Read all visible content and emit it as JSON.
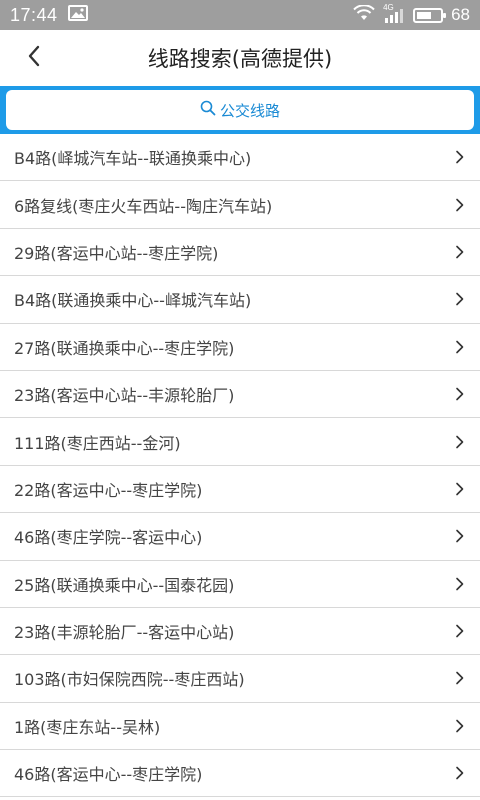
{
  "status_bar": {
    "time": "17:44",
    "network": "4G",
    "battery": "68",
    "battery_level": 0.68
  },
  "header": {
    "title": "线路搜索(高德提供)"
  },
  "search": {
    "label": "公交线路",
    "icon": "search-icon"
  },
  "routes": [
    {
      "label": "B4路(峄城汽车站--联通换乘中心)"
    },
    {
      "label": "6路复线(枣庄火车西站--陶庄汽车站)"
    },
    {
      "label": "29路(客运中心站--枣庄学院)"
    },
    {
      "label": "B4路(联通换乘中心--峄城汽车站)"
    },
    {
      "label": "27路(联通换乘中心--枣庄学院)"
    },
    {
      "label": "23路(客运中心站--丰源轮胎厂)"
    },
    {
      "label": "111路(枣庄西站--金河)"
    },
    {
      "label": "22路(客运中心--枣庄学院)"
    },
    {
      "label": "46路(枣庄学院--客运中心)"
    },
    {
      "label": "25路(联通换乘中心--国泰花园)"
    },
    {
      "label": "23路(丰源轮胎厂--客运中心站)"
    },
    {
      "label": "103路(市妇保院西院--枣庄西站)"
    },
    {
      "label": "1路(枣庄东站--吴林)"
    },
    {
      "label": "46路(客运中心--枣庄学院)"
    }
  ],
  "colors": {
    "accent": "#1e9be8",
    "search_text": "#1a8ad4",
    "status_bar": "#9e9e9e"
  }
}
